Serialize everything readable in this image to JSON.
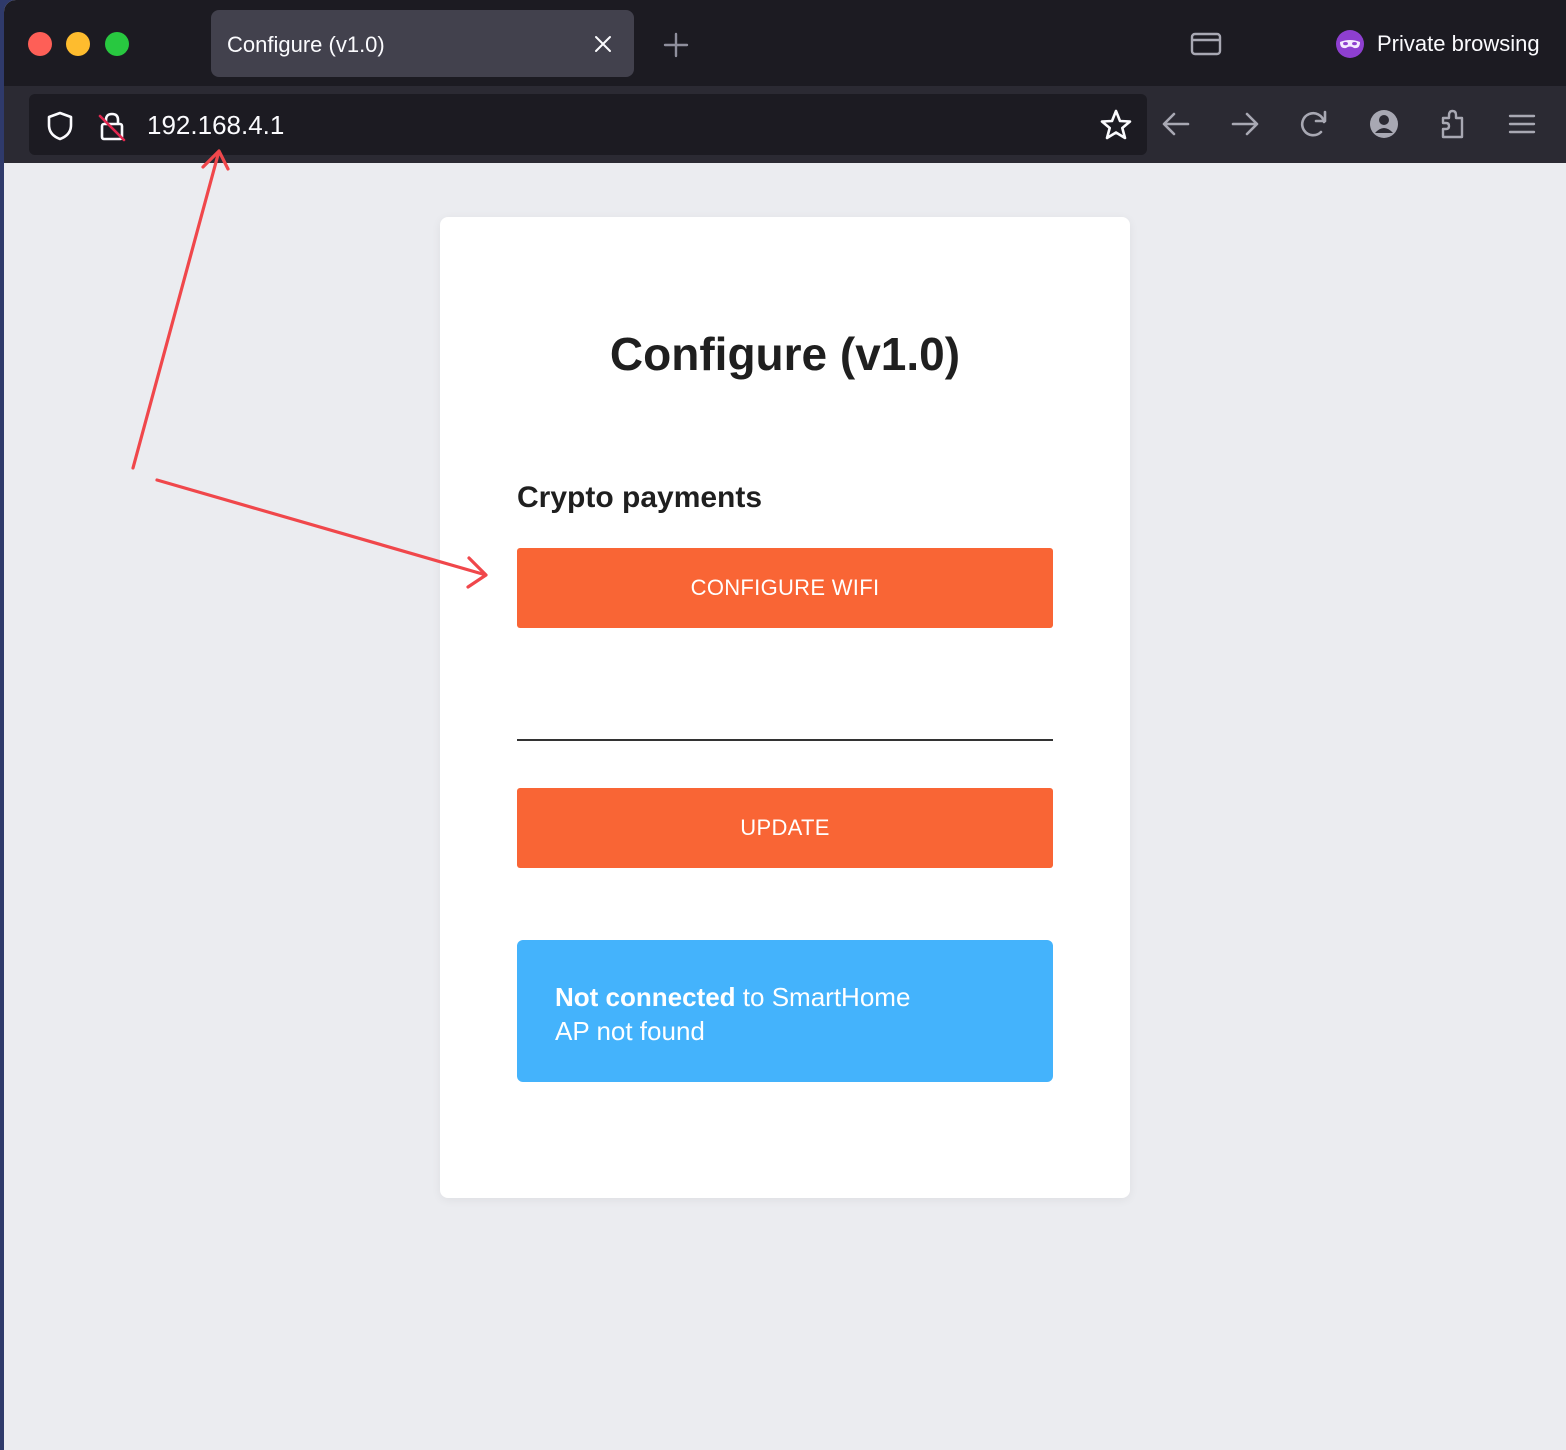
{
  "browser": {
    "tab_title": "Configure (v1.0)",
    "private_label": "Private browsing",
    "url": "192.168.4.1",
    "colors": {
      "titlebar": "#1c1b22",
      "toolbar": "#2b2a33",
      "private_accent": "#8e3fd0"
    },
    "icons": [
      "close-icon",
      "new-tab-icon",
      "window-icon",
      "private-mask-icon",
      "shield-icon",
      "insecure-lock-icon",
      "star-icon",
      "back-icon",
      "forward-icon",
      "reload-icon",
      "account-icon",
      "extensions-icon",
      "menu-icon"
    ]
  },
  "page": {
    "title": "Configure (v1.0)",
    "section_title": "Crypto payments",
    "configure_wifi_label": "CONFIGURE WIFI",
    "input_value": "",
    "update_label": "UPDATE",
    "status": {
      "strong": "Not connected",
      "rest": " to SmartHome",
      "line2": "AP not found"
    },
    "colors": {
      "button": "#f96535",
      "status_bg": "#44b3fc",
      "page_bg": "#ebecf0"
    }
  },
  "annotation": {
    "arrow_color": "#f0474b"
  }
}
